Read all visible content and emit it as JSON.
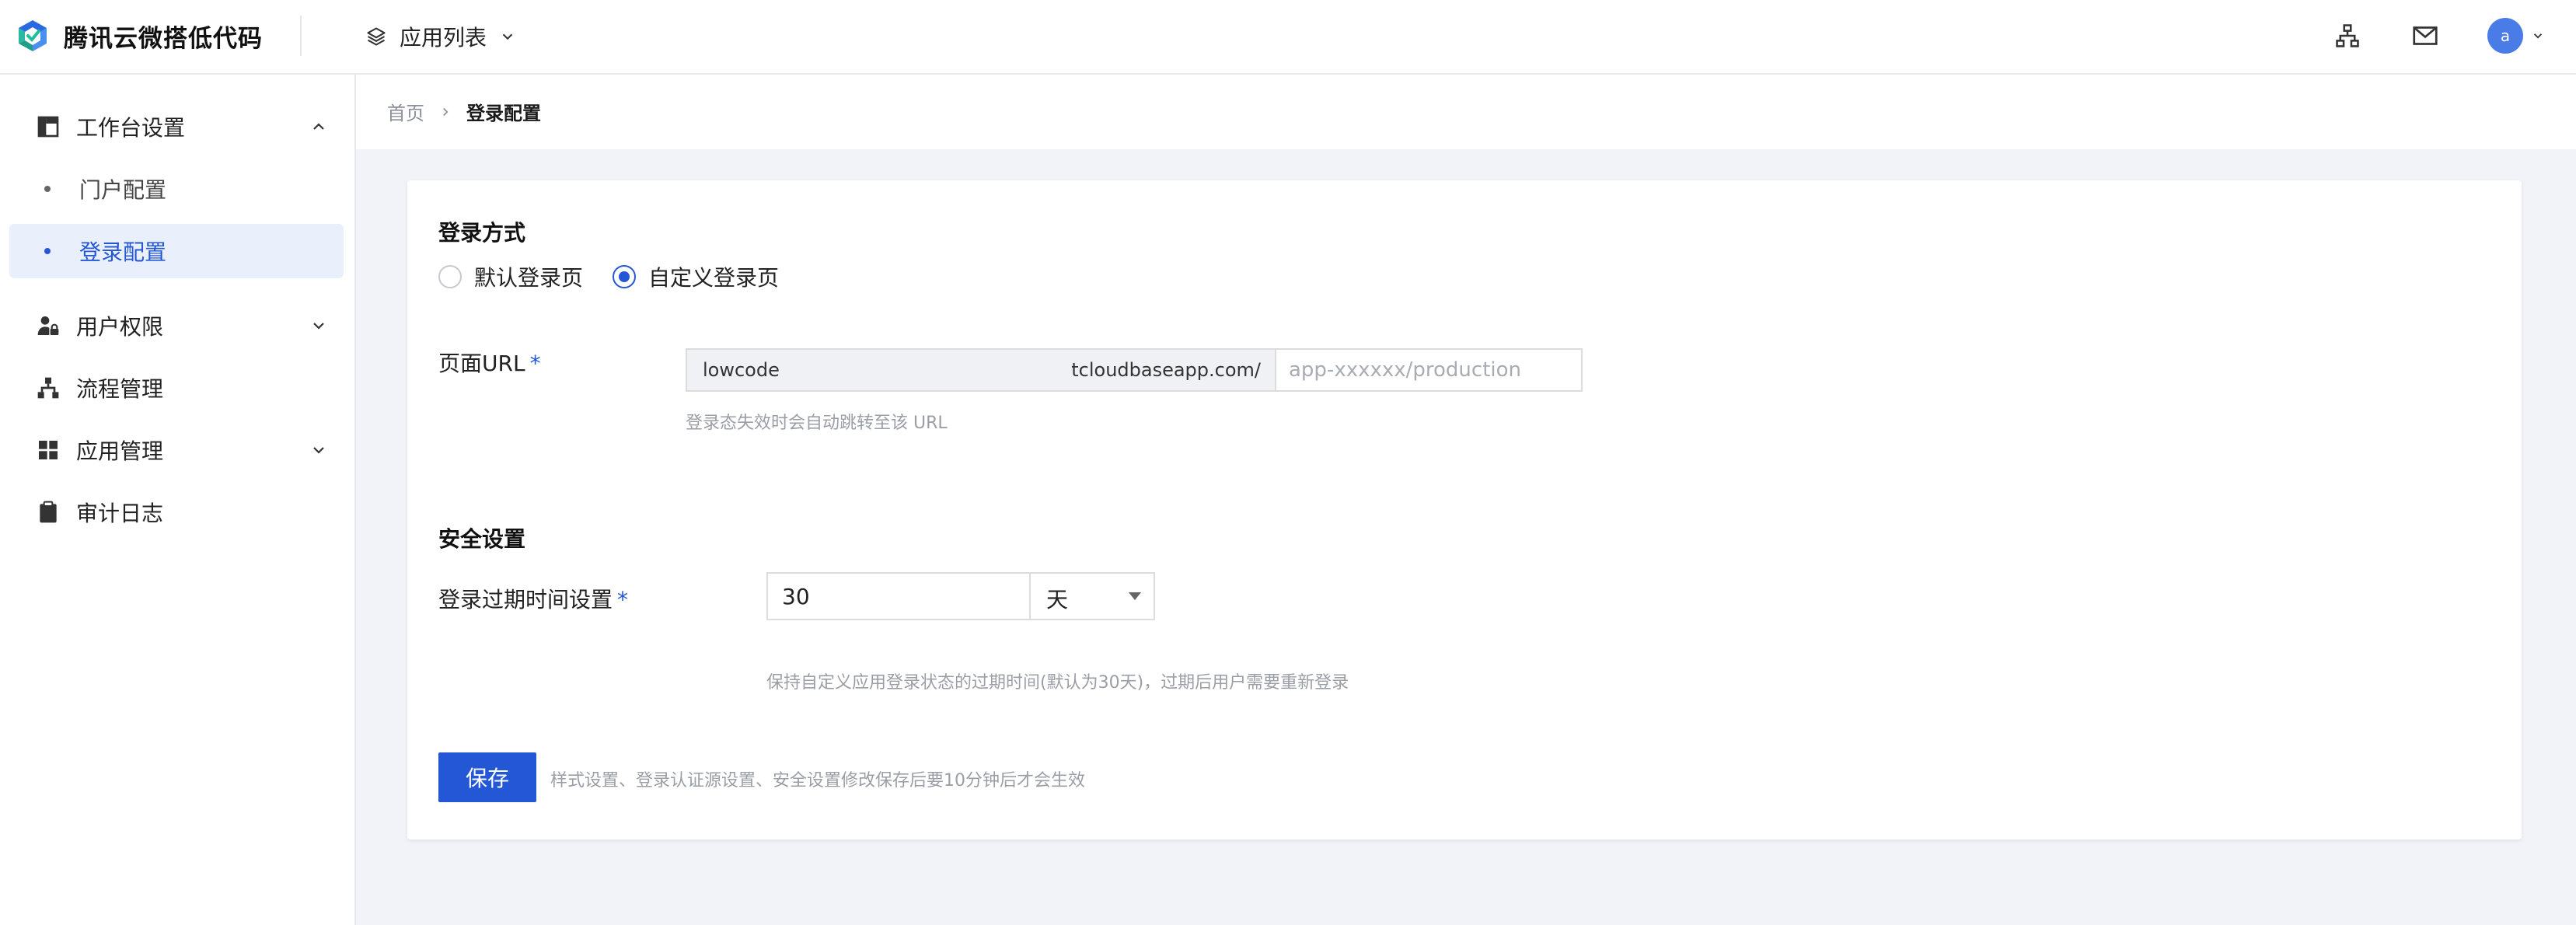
{
  "brand": {
    "name": "腾讯云微搭低代码"
  },
  "header": {
    "app_switch_label": "应用列表",
    "avatar_letter": "a",
    "icons": [
      "org-icon",
      "mail-icon"
    ]
  },
  "sidebar": {
    "items": [
      {
        "label": "工作台设置",
        "icon": "workbench-icon",
        "expanded": true
      },
      {
        "label": "门户配置",
        "sub": true
      },
      {
        "label": "登录配置",
        "sub": true,
        "active": true
      },
      {
        "label": "用户权限",
        "icon": "user-lock-icon",
        "expanded": false
      },
      {
        "label": "流程管理",
        "icon": "flow-icon"
      },
      {
        "label": "应用管理",
        "icon": "grid-icon",
        "expanded": false
      },
      {
        "label": "审计日志",
        "icon": "clipboard-icon"
      }
    ]
  },
  "breadcrumb": {
    "home": "首页",
    "current": "登录配置"
  },
  "login": {
    "section_title": "登录方式",
    "options": [
      {
        "label": "默认登录页",
        "checked": false
      },
      {
        "label": "自定义登录页",
        "checked": true
      }
    ],
    "url_label": "页面URL",
    "required_mark": "*",
    "url_prefix_left": "lowcode",
    "url_prefix_right": "tcloudbaseapp.com/",
    "url_placeholder": "app-xxxxxx/production",
    "url_hint": "登录态失效时会自动跳转至该 URL"
  },
  "security": {
    "section_title": "安全设置",
    "expire_label": "登录过期时间设置",
    "expire_value": "30",
    "unit_value": "天",
    "hint": "保持自定义应用登录状态的过期时间(默认为30天)，过期后用户需要重新登录"
  },
  "footer": {
    "save_label": "保存",
    "save_hint": "样式设置、登录认证源设置、安全设置修改保存后要10分钟后才会生效"
  },
  "colors": {
    "primary": "#2457d6",
    "avatar": "#4a7ce8",
    "page_bg": "#f2f3f8"
  }
}
